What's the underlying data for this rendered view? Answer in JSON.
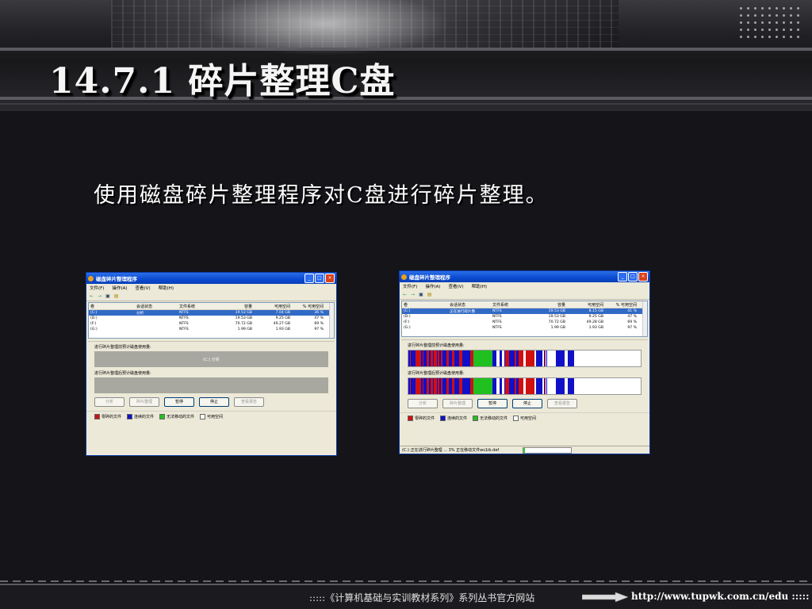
{
  "slide": {
    "title": "14.7.1  碎片整理C盘",
    "subtitle": "使用磁盘碎片整理程序对C盘进行碎片整理。"
  },
  "windows": [
    {
      "title": "磁盘碎片整理程序",
      "menu": [
        "文件(F)",
        "操作(A)",
        "查看(V)",
        "帮助(H)"
      ],
      "columns": [
        "卷",
        "会话状态",
        "文件系统",
        "容量",
        "可用空间",
        "% 可用空间"
      ],
      "rows": [
        {
          "vol": "(C:)",
          "state": "分析",
          "fs": "NTFS",
          "cap": "19.53 GB",
          "free": "7.04 GB",
          "pct": "36 %"
        },
        {
          "vol": "(D:)",
          "state": "",
          "fs": "NTFS",
          "cap": "19.53 GB",
          "free": "9.25 GB",
          "pct": "47 %"
        },
        {
          "vol": "(F:)",
          "state": "",
          "fs": "NTFS",
          "cap": "70.72 GB",
          "free": "49.27 GB",
          "pct": "69 %"
        },
        {
          "vol": "(G:)",
          "state": "",
          "fs": "NTFS",
          "cap": "1.99 GB",
          "free": "1.93 GB",
          "pct": "97 %"
        }
      ],
      "before_label": "进行碎片整理前预计磁盘使用量:",
      "before_text": "(C:) 分析",
      "after_label": "进行碎片整理后预计磁盘使用量:",
      "buttons": [
        "分析",
        "碎片整理",
        "暂停",
        "停止",
        "查看报告"
      ],
      "legend": [
        "零碎的文件",
        "连续的文件",
        "无法移动的文件",
        "可用空间"
      ]
    },
    {
      "title": "磁盘碎片整理程序",
      "menu": [
        "文件(F)",
        "操作(A)",
        "查看(V)",
        "帮助(H)"
      ],
      "columns": [
        "卷",
        "会话状态",
        "文件系统",
        "容量",
        "可用空间",
        "% 可用空间"
      ],
      "rows": [
        {
          "vol": "(C:)",
          "state": "正在进行碎片整",
          "fs": "NTFS",
          "cap": "19.53 GB",
          "free": "8.15 GB",
          "pct": "41 %"
        },
        {
          "vol": "(D:)",
          "state": "",
          "fs": "NTFS",
          "cap": "19.53 GB",
          "free": "9.25 GB",
          "pct": "47 %"
        },
        {
          "vol": "(F:)",
          "state": "",
          "fs": "NTFS",
          "cap": "70.72 GB",
          "free": "49.28 GB",
          "pct": "69 %"
        },
        {
          "vol": "(G:)",
          "state": "",
          "fs": "NTFS",
          "cap": "1.99 GB",
          "free": "1.93 GB",
          "pct": "97 %"
        }
      ],
      "before_label": "进行碎片整理前预计磁盘使用量:",
      "after_label": "进行碎片整理后预计磁盘使用量:",
      "buttons": [
        "分析",
        "碎片整理",
        "暂停",
        "停止",
        "查看报告"
      ],
      "legend": [
        "零碎的文件",
        "连续的文件",
        "无法移动的文件",
        "可用空间"
      ],
      "status": "(C:) 正在进行碎片整理 ... 3%  正在移动文件ws1ib.def",
      "progress_fraction": 0.03
    }
  ],
  "colors": {
    "fragmented": "#d01010",
    "contiguous": "#1010c8",
    "unmovable": "#20c020",
    "free": "#ffffff"
  },
  "footer": {
    "text": ":::::《计算机基础与实训教材系列》系列丛书官方网站",
    "url": "http://www.tupwk.com.cn/edu  :::::"
  }
}
